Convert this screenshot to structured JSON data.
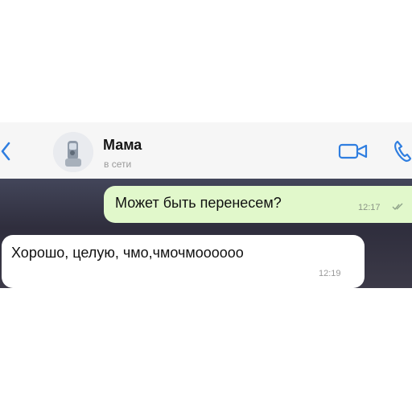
{
  "header": {
    "back_icon": "chevron-left-icon",
    "contact_name": "Мама",
    "contact_status": "в сети",
    "video_icon": "video-camera-icon",
    "call_icon": "phone-icon",
    "accent_color": "#2f7ee0"
  },
  "messages": [
    {
      "direction": "outgoing",
      "text": "Может быть перенесем?",
      "time": "12:17",
      "status_icon": "double-check-icon",
      "bubble_color": "#e1f8cb"
    },
    {
      "direction": "incoming",
      "text": "Хорошо, целую, чмо,чмочмоооооо",
      "time": "12:19",
      "bubble_color": "#ffffff"
    }
  ]
}
